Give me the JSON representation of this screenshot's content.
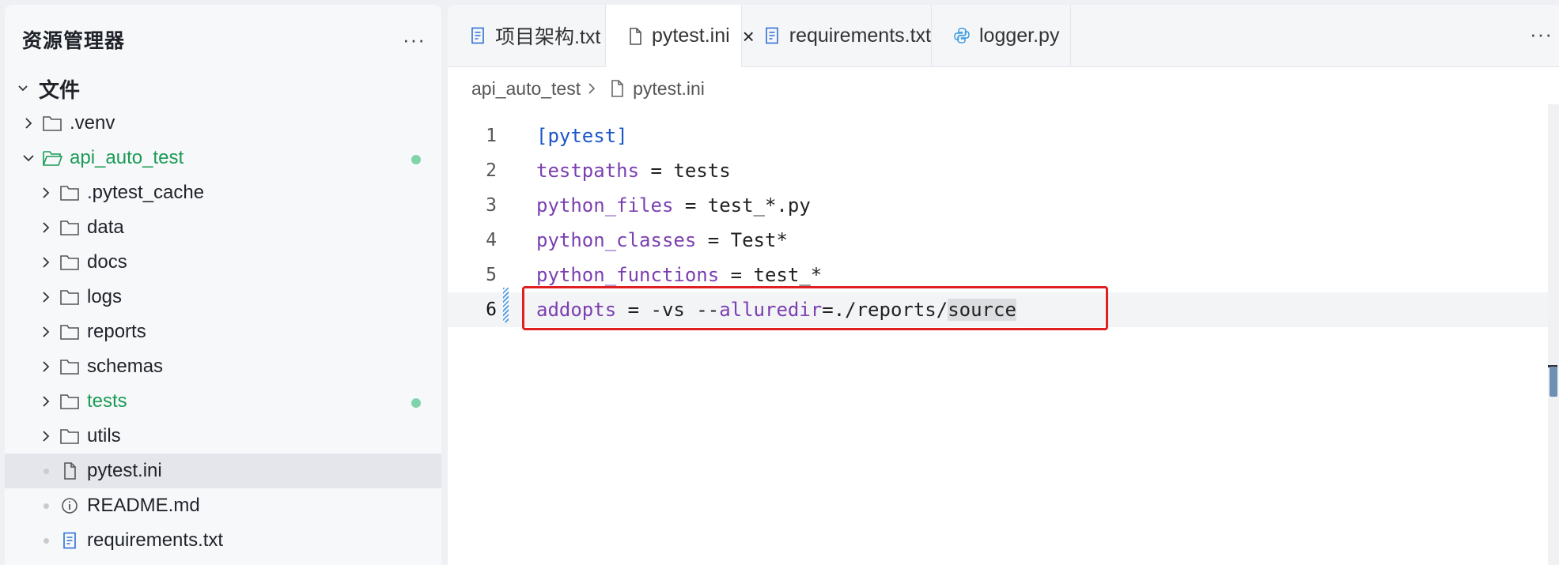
{
  "sidebar": {
    "title": "资源管理器",
    "more": "···",
    "section": "文件",
    "items": [
      {
        "label": ".venv",
        "type": "folder",
        "level": 0,
        "chevron": "right"
      },
      {
        "label": "api_auto_test",
        "type": "folder-open",
        "level": 0,
        "chevron": "down",
        "status": "modified"
      },
      {
        "label": ".pytest_cache",
        "type": "folder",
        "level": 1,
        "chevron": "right"
      },
      {
        "label": "data",
        "type": "folder",
        "level": 1,
        "chevron": "right"
      },
      {
        "label": "docs",
        "type": "folder",
        "level": 1,
        "chevron": "right"
      },
      {
        "label": "logs",
        "type": "folder",
        "level": 1,
        "chevron": "right"
      },
      {
        "label": "reports",
        "type": "folder",
        "level": 1,
        "chevron": "right"
      },
      {
        "label": "schemas",
        "type": "folder",
        "level": 1,
        "chevron": "right"
      },
      {
        "label": "tests",
        "type": "folder",
        "level": 1,
        "chevron": "right",
        "status": "modified"
      },
      {
        "label": "utils",
        "type": "folder",
        "level": 1,
        "chevron": "right"
      },
      {
        "label": "pytest.ini",
        "type": "file",
        "level": 1,
        "selected": true
      },
      {
        "label": "README.md",
        "type": "info",
        "level": 1
      },
      {
        "label": "requirements.txt",
        "type": "text",
        "level": 1
      }
    ]
  },
  "tabs": [
    {
      "label": "项目架构.txt",
      "icon": "text-file-icon"
    },
    {
      "label": "pytest.ini",
      "icon": "file-icon",
      "active": true,
      "close": "×"
    },
    {
      "label": "requirements.txt",
      "icon": "text-file-icon"
    },
    {
      "label": "logger.py",
      "icon": "python-icon"
    }
  ],
  "tab_more": "···",
  "breadcrumb": {
    "folder": "api_auto_test",
    "file": "pytest.ini"
  },
  "editor": {
    "lines": [
      {
        "num": "1",
        "parts": [
          {
            "t": "[pytest]",
            "c": "b"
          }
        ]
      },
      {
        "num": "2",
        "parts": [
          {
            "t": "testpaths",
            "c": "k"
          },
          {
            "t": " = tests",
            "c": ""
          }
        ]
      },
      {
        "num": "3",
        "parts": [
          {
            "t": "python_files",
            "c": "k"
          },
          {
            "t": " = test_*.py",
            "c": ""
          }
        ]
      },
      {
        "num": "4",
        "parts": [
          {
            "t": "python_classes",
            "c": "k"
          },
          {
            "t": " = Test*",
            "c": ""
          }
        ]
      },
      {
        "num": "5",
        "parts": [
          {
            "t": "python_functions",
            "c": "k"
          },
          {
            "t": " = test_*",
            "c": ""
          }
        ]
      },
      {
        "num": "6",
        "current": true,
        "parts": [
          {
            "t": "addopts",
            "c": "k"
          },
          {
            "t": " = -vs --",
            "c": ""
          },
          {
            "t": "alluredir",
            "c": "k"
          },
          {
            "t": "=./reports/",
            "c": ""
          },
          {
            "t": "source",
            "c": "sel"
          }
        ]
      }
    ]
  },
  "colors": {
    "green": "#1a9b55",
    "keyword": "#7b3fb0",
    "bracket": "#1b57c9",
    "highlight": "#e02020"
  }
}
